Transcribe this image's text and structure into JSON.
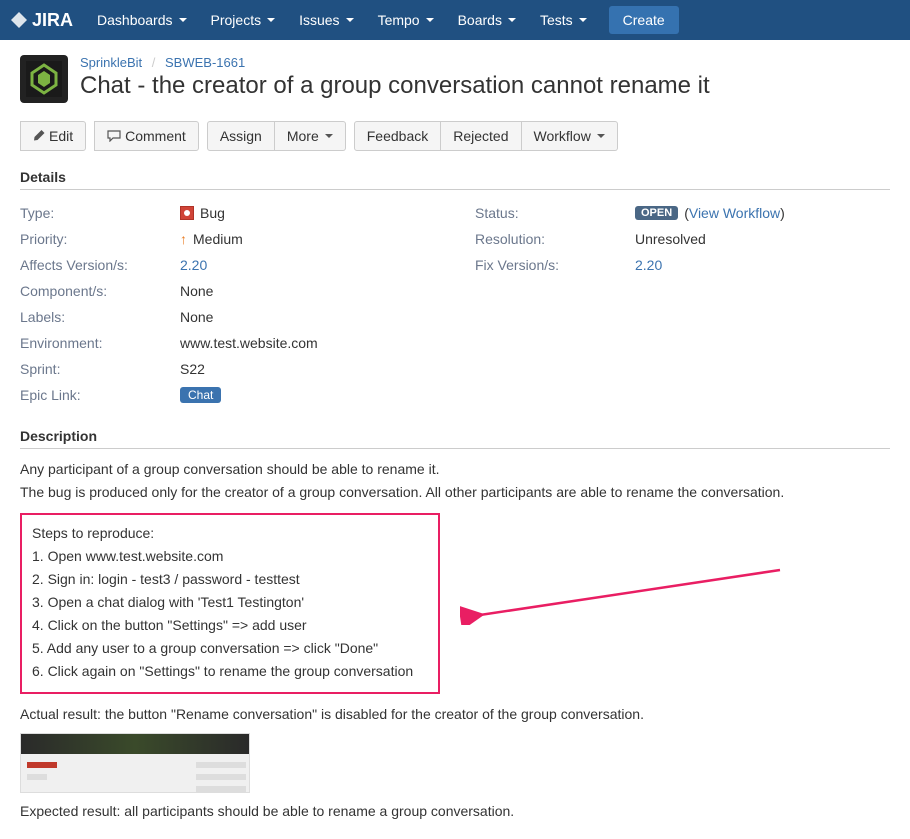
{
  "nav": {
    "logo": "JIRA",
    "items": [
      "Dashboards",
      "Projects",
      "Issues",
      "Tempo",
      "Boards",
      "Tests"
    ],
    "create": "Create"
  },
  "breadcrumb": {
    "project": "SprinkleBit",
    "key": "SBWEB-1661"
  },
  "issue": {
    "title": "Chat - the creator of a group conversation cannot rename it"
  },
  "actions": {
    "edit": "Edit",
    "comment": "Comment",
    "assign": "Assign",
    "more": "More",
    "feedback": "Feedback",
    "rejected": "Rejected",
    "workflow": "Workflow"
  },
  "sections": {
    "details": "Details",
    "description": "Description"
  },
  "details": {
    "type_label": "Type:",
    "type_value": "Bug",
    "priority_label": "Priority:",
    "priority_value": "Medium",
    "affects_label": "Affects Version/s:",
    "affects_value": "2.20",
    "components_label": "Component/s:",
    "components_value": "None",
    "labels_label": "Labels:",
    "labels_value": "None",
    "environment_label": "Environment:",
    "environment_value": "www.test.website.com",
    "sprint_label": "Sprint:",
    "sprint_value": "S22",
    "epic_label": "Epic Link:",
    "epic_value": "Chat",
    "status_label": "Status:",
    "status_value": "OPEN",
    "view_workflow": "View Workflow",
    "resolution_label": "Resolution:",
    "resolution_value": "Unresolved",
    "fixversion_label": "Fix Version/s:",
    "fixversion_value": "2.20"
  },
  "description": {
    "intro1": "Any participant of a group conversation should be able to rename it.",
    "intro2": "The bug is produced only for the creator of a group conversation. All other participants are able to rename the conversation.",
    "steps_title": "Steps to reproduce:",
    "steps": [
      "1. Open www.test.website.com",
      "2. Sign in: login - test3 / password - testtest",
      "3. Open a chat dialog with 'Test1 Testington'",
      "4. Click on the button \"Settings\" => add user",
      "5. Add any user to a group conversation => click \"Done\"",
      "6. Click again on \"Settings\" to rename the group conversation"
    ],
    "actual": "Actual result: the button \"Rename conversation\" is disabled for the creator of the group conversation.",
    "expected": "Expected result: all participants should be able to rename a group conversation."
  }
}
